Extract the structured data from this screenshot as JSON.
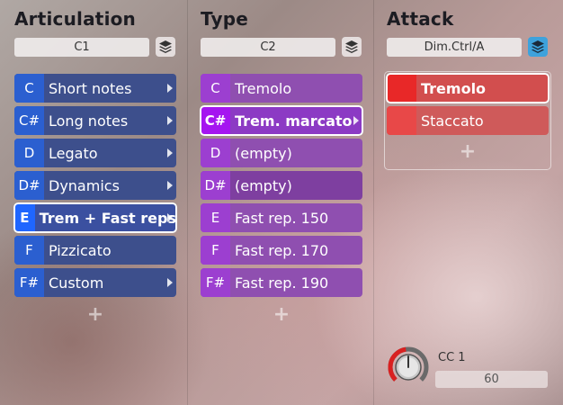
{
  "articulation": {
    "title": "Articulation",
    "selector": "C1",
    "layer_icon": "layers-icon",
    "rows": [
      {
        "key": "C",
        "label": "Short notes"
      },
      {
        "key": "C#",
        "label": "Long notes"
      },
      {
        "key": "D",
        "label": "Legato"
      },
      {
        "key": "D#",
        "label": "Dynamics"
      },
      {
        "key": "E",
        "label": "Trem + Fast reps"
      },
      {
        "key": "F",
        "label": "Pizzicato"
      },
      {
        "key": "F#",
        "label": "Custom"
      }
    ],
    "add": "+"
  },
  "type": {
    "title": "Type",
    "selector": "C2",
    "layer_icon": "layers-icon",
    "rows": [
      {
        "key": "C",
        "label": "Tremolo"
      },
      {
        "key": "C#",
        "label": "Trem. marcato"
      },
      {
        "key": "D",
        "label": "(empty)"
      },
      {
        "key": "D#",
        "label": "(empty)"
      },
      {
        "key": "E",
        "label": "Fast rep. 150"
      },
      {
        "key": "F",
        "label": "Fast rep. 170"
      },
      {
        "key": "F#",
        "label": "Fast rep. 190"
      }
    ],
    "add": "+"
  },
  "attack": {
    "title": "Attack",
    "selector": "Dim.Ctrl/A",
    "layer_icon": "layers-icon",
    "rows": [
      {
        "label": "Tremolo"
      },
      {
        "label": "Staccato"
      }
    ],
    "add": "+"
  },
  "cc": {
    "label": "CC 1",
    "value": "60",
    "knob_level": 0.47
  },
  "colors": {
    "articulation_key": "#2b5fd0",
    "type_key": "#9c3fd0",
    "attack_key": "#e82828",
    "active_layer": "#3ea2dc"
  }
}
